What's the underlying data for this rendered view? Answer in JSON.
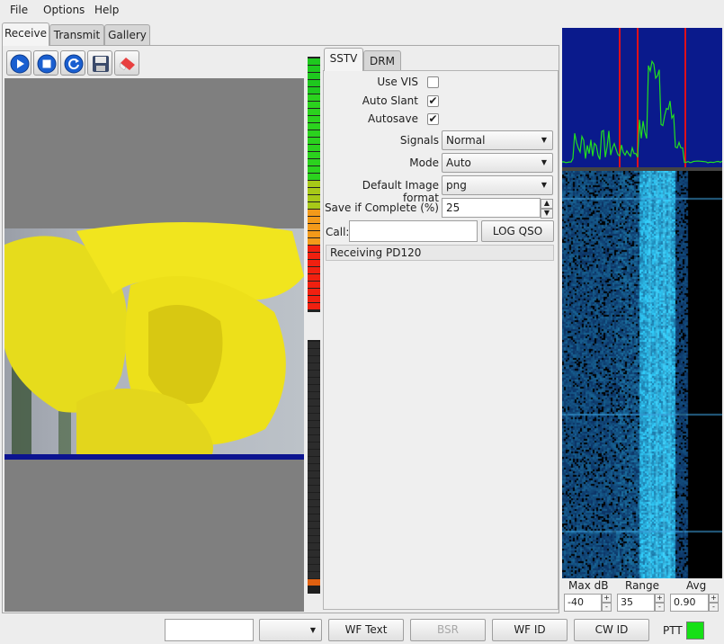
{
  "menu": {
    "file": "File",
    "options": "Options",
    "help": "Help"
  },
  "main_tabs": {
    "receive": "Receive",
    "transmit": "Transmit",
    "gallery": "Gallery"
  },
  "toolbar": {
    "icons": [
      "play-icon",
      "stop-icon",
      "refresh-icon",
      "save-icon",
      "eraser-icon"
    ]
  },
  "mode_tabs": {
    "sstv": "SSTV",
    "drm": "DRM"
  },
  "settings": {
    "use_vis_label": "Use VIS",
    "use_vis_checked": false,
    "auto_slant_label": "Auto Slant",
    "auto_slant_checked": true,
    "autosave_label": "Autosave",
    "autosave_checked": true,
    "check_mark": "✔",
    "signals_label": "Signals",
    "signals_value": "Normal",
    "mode_label": "Mode",
    "mode_value": "Auto",
    "image_format_label": "Default Image format",
    "image_format_value": "png",
    "save_complete_label": "Save if Complete (%)",
    "save_complete_value": "25",
    "call_label": "Call:",
    "call_value": "",
    "log_qso_label": "LOG QSO",
    "status_text": "Receiving PD120"
  },
  "spectrum_controls": {
    "max_db_label": "Max dB",
    "max_db_value": "-40",
    "range_label": "Range",
    "range_value": "35",
    "avg_label": "Avg",
    "avg_value": "0.90"
  },
  "bottom_bar": {
    "text_field_value": "",
    "combo_value": "",
    "wf_text": "WF Text",
    "bsr": "BSR",
    "wf_id": "WF ID",
    "cw_id": "CW ID",
    "ptt": "PTT"
  },
  "colors": {
    "vu_green": "#2bd21e",
    "vu_orange": "#f39a1a",
    "vu_red": "#f02010",
    "spectrum_bg": "#0a1a8c",
    "spectrum_trace": "#22e020",
    "marker_red": "#e0101a",
    "waterfall_cyan": "#3fd0ff",
    "ptt_on": "#16e016",
    "progress_bar": "#0c1490"
  }
}
